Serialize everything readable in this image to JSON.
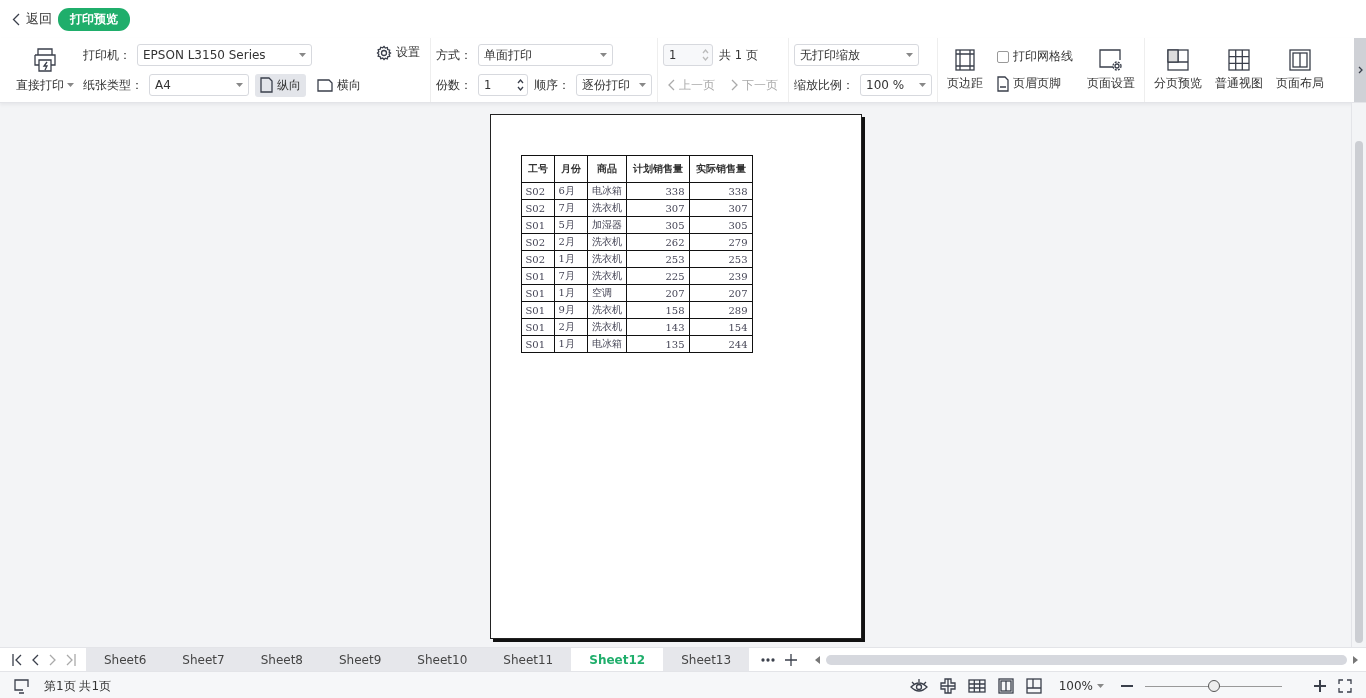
{
  "topbar": {
    "back": "返回",
    "title": "打印预览"
  },
  "toolbar": {
    "print_button": "直接打印",
    "printer": {
      "label": "打印机：",
      "value": "EPSON L3150 Series"
    },
    "settings": "设置",
    "paper": {
      "label": "纸张类型：",
      "value": "A4"
    },
    "orientation": [
      {
        "label": "纵向",
        "selected": true
      },
      {
        "label": "横向",
        "selected": false
      }
    ],
    "mode": {
      "label": "方式：",
      "value": "单面打印"
    },
    "copies": {
      "label": "份数：",
      "value": "1"
    },
    "order": {
      "label": "顺序：",
      "value": "逐份打印"
    },
    "page_input": "1",
    "page_total": "共 1 页",
    "prev_page": "上一页",
    "next_page": "下一页",
    "scaling": "无打印缩放",
    "zoom": {
      "label": "缩放比例：",
      "value": "100 %"
    },
    "margins": "页边距",
    "gridlines": {
      "label": "打印网格线",
      "checked": false
    },
    "header_footer": "页眉页脚",
    "page_setup": "页面设置",
    "views": [
      "分页预览",
      "普通视图",
      "页面布局"
    ]
  },
  "preview_table": {
    "columns": [
      "工号",
      "月份",
      "商品",
      "计划销售量",
      "实际销售量"
    ],
    "rows": [
      [
        "S02",
        "6月",
        "电冰箱",
        "338",
        "338"
      ],
      [
        "S02",
        "7月",
        "洗衣机",
        "307",
        "307"
      ],
      [
        "S01",
        "5月",
        "加湿器",
        "305",
        "305"
      ],
      [
        "S02",
        "2月",
        "洗衣机",
        "262",
        "279"
      ],
      [
        "S02",
        "1月",
        "洗衣机",
        "253",
        "253"
      ],
      [
        "S01",
        "7月",
        "洗衣机",
        "225",
        "239"
      ],
      [
        "S01",
        "1月",
        "空调",
        "207",
        "207"
      ],
      [
        "S01",
        "9月",
        "洗衣机",
        "158",
        "289"
      ],
      [
        "S01",
        "2月",
        "洗衣机",
        "143",
        "154"
      ],
      [
        "S01",
        "1月",
        "电冰箱",
        "135",
        "244"
      ]
    ]
  },
  "sheet_tabs": [
    {
      "label": "Sheet6",
      "selected": false
    },
    {
      "label": "Sheet7",
      "selected": false
    },
    {
      "label": "Sheet8",
      "selected": false
    },
    {
      "label": "Sheet9",
      "selected": false
    },
    {
      "label": "Sheet10",
      "selected": false
    },
    {
      "label": "Sheet11",
      "selected": false
    },
    {
      "label": "Sheet12",
      "selected": true
    },
    {
      "label": "Sheet13",
      "selected": false
    }
  ],
  "status_bar": {
    "page_info": "第1页 共1页",
    "zoom": "100%",
    "zoom_slider": {
      "level": 0.5
    }
  }
}
